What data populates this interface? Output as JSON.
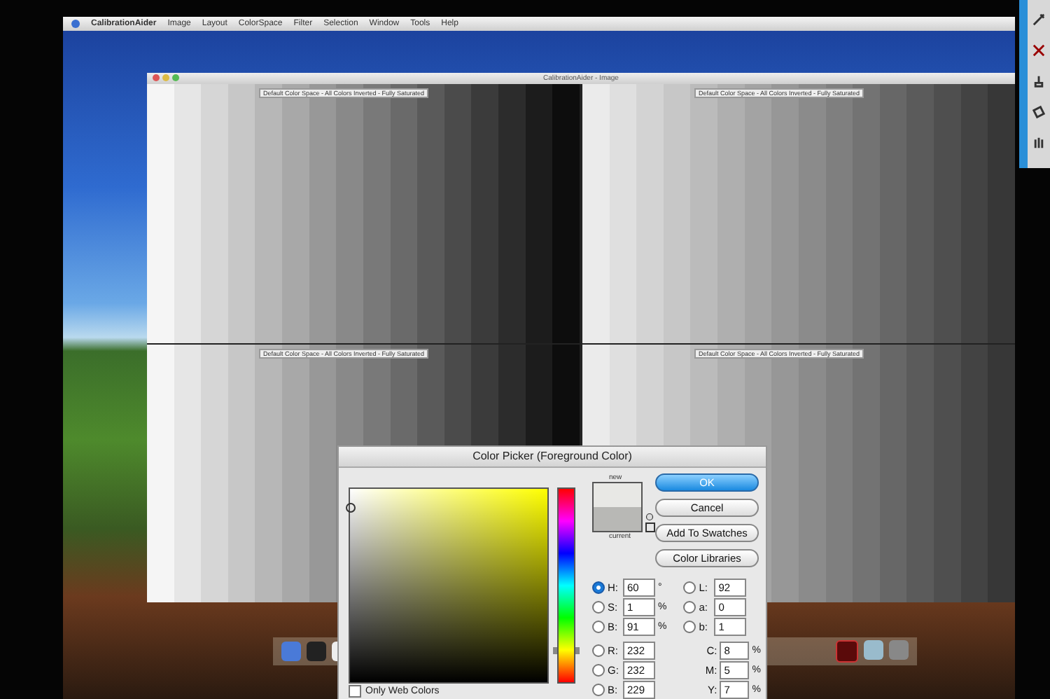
{
  "menu_bar": {
    "items": [
      "CalibrationAider",
      "Image",
      "Layout",
      "ColorSpace",
      "Filter",
      "Selection",
      "Window",
      "Tools",
      "Help"
    ]
  },
  "window": {
    "title": "CalibrationAider - Image",
    "panels": [
      {
        "label": "Default Color Space - All Colors Inverted - Fully Saturated"
      },
      {
        "label": "Default Color Space - All Colors Inverted - Fully Saturated"
      },
      {
        "label": "Default Color Space - All Colors Inverted - Fully Saturated"
      },
      {
        "label": "Default Color Space - All Colors Inverted - Fully Saturated"
      }
    ]
  },
  "color_picker": {
    "title": "Color Picker (Foreground Color)",
    "new_label": "new",
    "current_label": "current",
    "buttons": [
      {
        "label": "OK",
        "default": true
      },
      {
        "label": "Cancel",
        "default": false
      },
      {
        "label": "Add To Swatches",
        "default": false
      },
      {
        "label": "Color Libraries",
        "default": false
      }
    ],
    "fields": [
      {
        "label": "H:",
        "value": "60",
        "unit": "°",
        "selected": true
      },
      {
        "label": "S:",
        "value": "1",
        "unit": "%",
        "selected": false
      },
      {
        "label": "B:",
        "value": "91",
        "unit": "%",
        "selected": false
      },
      {
        "label": "R:",
        "value": "232",
        "selected": false
      },
      {
        "label": "G:",
        "value": "232",
        "selected": false
      },
      {
        "label": "B:",
        "value": "229",
        "selected": false
      }
    ],
    "lab_fields": [
      {
        "label": "L:",
        "value": "92",
        "selected": false
      },
      {
        "label": "a:",
        "value": "0",
        "selected": false
      },
      {
        "label": "b:",
        "value": "1",
        "selected": false
      }
    ],
    "cmyk_fields": [
      {
        "label": "C:",
        "value": "8",
        "unit": "%"
      },
      {
        "label": "M:",
        "value": "5",
        "unit": "%"
      },
      {
        "label": "Y:",
        "value": "7",
        "unit": "%"
      }
    ],
    "hue_slider": {
      "level": 0.17
    },
    "only_web_colors": {
      "label": "Only Web Colors",
      "checked": false
    }
  }
}
